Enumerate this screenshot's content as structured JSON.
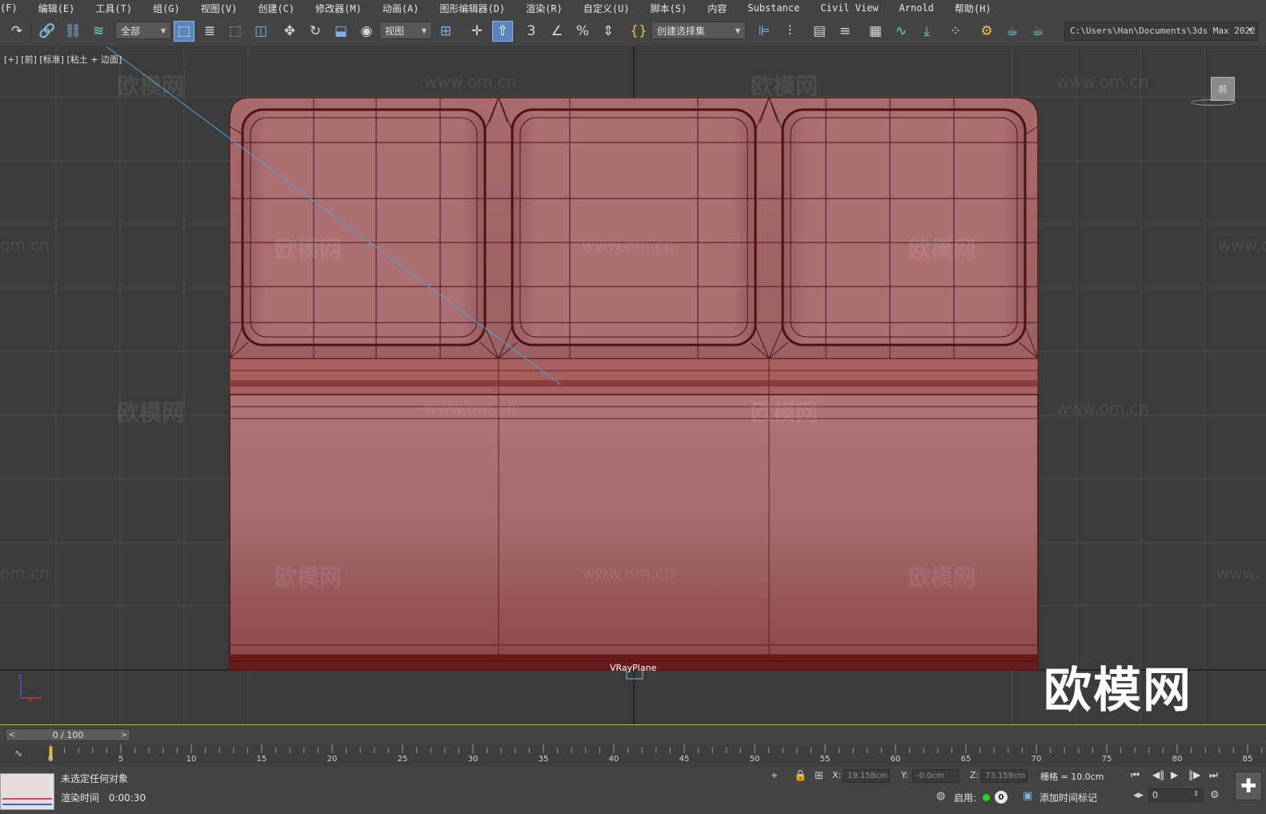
{
  "menu": [
    "(F)",
    "编辑(E)",
    "工具(T)",
    "组(G)",
    "视图(V)",
    "创建(C)",
    "修改器(M)",
    "动画(A)",
    "图形编辑器(D)",
    "渲染(R)",
    "自定义(U)",
    "脚本(S)",
    "内容",
    "Substance",
    "Civil View",
    "Arnold",
    "帮助(H)"
  ],
  "toolbar": {
    "selection_filter": "全部",
    "ref_coord": "视图",
    "selection_set": "创建选择集",
    "project_path": "C:\\Users\\Han\\Documents\\3ds Max 2022"
  },
  "viewport": {
    "label": "[+] [前] [标准] [粘土 + 边面]",
    "object_label": "VRayPlane",
    "viewcube_text": "前",
    "watermark_brand": "欧模网",
    "watermark_url": "www.om.cn",
    "watermark_url_partial": "om.cn",
    "watermark_url_partial_right": "www.",
    "watermark_url_edge": "www.o",
    "logo_big": "欧模网",
    "colors": {
      "model": "#a8676a",
      "model_dark": "#7a2b2b",
      "background": "#3c3c3c",
      "grid": "#535353"
    }
  },
  "timeline": {
    "frame_display": "0 / 100",
    "ticks": [
      "0",
      "5",
      "10",
      "15",
      "20",
      "25",
      "30",
      "35",
      "40",
      "45",
      "50",
      "55",
      "60",
      "65",
      "70",
      "75",
      "80",
      "85"
    ]
  },
  "status": {
    "selection": "未选定任何对象",
    "render_time_label": "渲染时间",
    "render_time_value": "0:00:30",
    "x_label": "X:",
    "x_value": "19.158cm",
    "y_label": "Y:",
    "y_value": "-0.0cm",
    "z_label": "Z:",
    "z_value": "73.159cm",
    "grid": "栅格 = 10.0cm",
    "enable_label": "启用:",
    "enable_count": "0",
    "add_time_tag": "添加时间标记",
    "frame_value": "0"
  }
}
